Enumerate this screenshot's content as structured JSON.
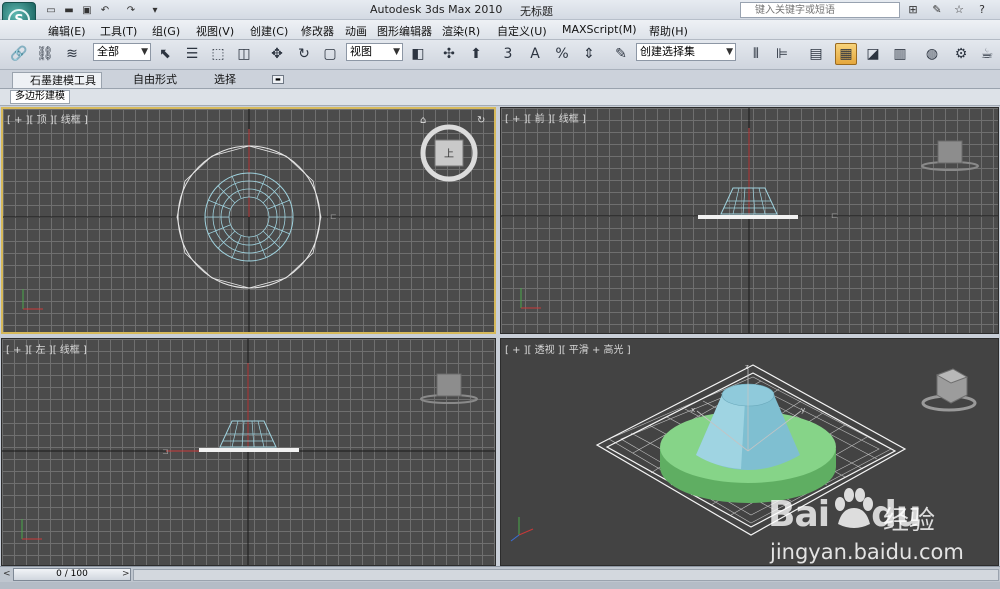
{
  "app": {
    "title": "Autodesk 3ds Max  2010",
    "document": "无标题",
    "logo_glyph": "S",
    "help_search_placeholder": "键入关键字或短语"
  },
  "quick_access": [
    {
      "icon": "new-file-icon",
      "glyph": "▭"
    },
    {
      "icon": "open-file-icon",
      "glyph": "▬"
    },
    {
      "icon": "save-icon",
      "glyph": "▣"
    },
    {
      "icon": "undo-icon",
      "glyph": "↶"
    },
    {
      "icon": "redo-icon",
      "glyph": "↷"
    },
    {
      "icon": "customize-dropdown-icon",
      "glyph": "▾"
    }
  ],
  "window_controls": [
    {
      "icon": "binoculars-icon",
      "glyph": "⊞"
    },
    {
      "icon": "tools-icon",
      "glyph": "✎"
    },
    {
      "icon": "star-icon",
      "glyph": "☆"
    },
    {
      "icon": "help-icon",
      "glyph": "?"
    }
  ],
  "menu": [
    "编辑(E)",
    "工具(T)",
    "组(G)",
    "视图(V)",
    "创建(C)",
    "修改器",
    "动画",
    "图形编辑器",
    "渲染(R)",
    "自定义(U)",
    "MAXScript(M)",
    "帮助(H)"
  ],
  "toolbar": {
    "selection_filter": "全部",
    "reference_coord": "视图",
    "named_selection": "创建选择集",
    "snap_3": "3",
    "snap_angle": "A",
    "snap_percent": "%"
  },
  "ribbon": {
    "tabs": [
      "石墨建模工具",
      "自由形式",
      "选择"
    ],
    "panel_label": "多边形建模"
  },
  "viewports": {
    "top": "[ + ][ 顶 ][ 线框 ]",
    "front": "[ + ][ 前 ][ 线框 ]",
    "left": "[ + ][ 左 ][ 线框 ]",
    "perspective": "[ + ][ 透视 ][ 平滑 + 高光 ]",
    "viewcube_face": "上"
  },
  "timeline": {
    "frame": "0 / 100",
    "prev": "<",
    "next": ">"
  },
  "watermark": {
    "brand": "Bai",
    "brand2": "du",
    "jingyan": "经验",
    "url": "jingyan.baidu.com"
  },
  "colors": {
    "viewport_active_border": "#d6b95b",
    "wire_blue": "#9fd2de",
    "cone_shading": "#7fbfd1",
    "ring_green": "#79c77a"
  }
}
